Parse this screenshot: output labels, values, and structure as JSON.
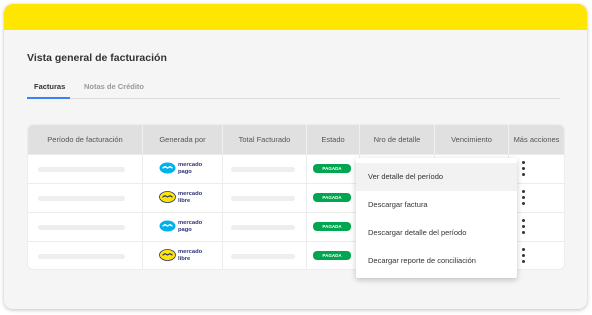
{
  "header": {
    "title": "Vista general de facturación"
  },
  "tabs": [
    {
      "label": "Facturas",
      "active": true
    },
    {
      "label": "Notas de Crédito",
      "active": false
    }
  ],
  "table": {
    "columns": [
      "Período de facturación",
      "Generada por",
      "Total Facturado",
      "Estado",
      "Nro de detalle",
      "Vencimiento",
      "Más acciones"
    ],
    "rows": [
      {
        "generated_by": {
          "line1": "mercado",
          "line2": "pago",
          "brand": "mercado-pago"
        },
        "status": "PAGADA"
      },
      {
        "generated_by": {
          "line1": "mercado",
          "line2": "libre",
          "brand": "mercado-libre"
        },
        "status": "PAGADA"
      },
      {
        "generated_by": {
          "line1": "mercado",
          "line2": "pago",
          "brand": "mercado-pago"
        },
        "status": "PAGADA"
      },
      {
        "generated_by": {
          "line1": "mercado",
          "line2": "libre",
          "brand": "mercado-libre"
        },
        "status": "PAGADA"
      }
    ]
  },
  "menu": {
    "items": [
      "Ver detalle del período",
      "Descargar factura",
      "Descargar detalle del período",
      "Decargar reporte de conciliación"
    ]
  },
  "colors": {
    "topbar": "#ffe600",
    "paid_badge": "#00a650",
    "tab_underline": "#3483fa",
    "brand_text": "#2d3277",
    "mercado_pago_logo": "#00b1ea",
    "mercado_libre_logo": "#ffe600"
  },
  "icons": {
    "row_actions": "more-vertical-icon",
    "mercado_pago": "mercado-pago-handshake-icon",
    "mercado_libre": "mercado-libre-handshake-icon"
  }
}
